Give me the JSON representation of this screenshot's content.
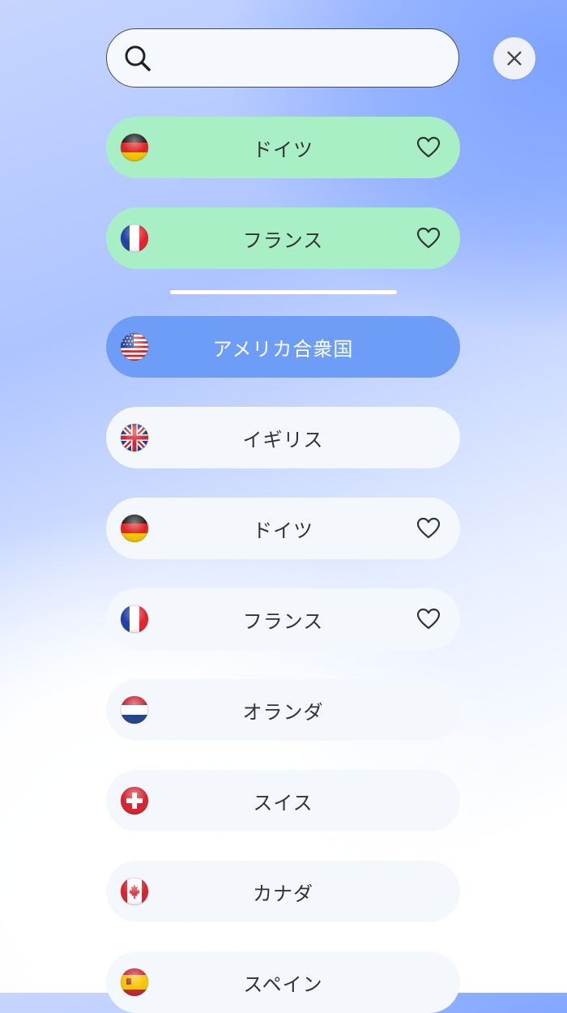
{
  "search": {
    "value": "",
    "placeholder": ""
  },
  "favorites": [
    {
      "name": "ドイツ",
      "flag": "germany-flag",
      "favorite": true
    },
    {
      "name": "フランス",
      "flag": "france-flag",
      "favorite": true
    }
  ],
  "countries": [
    {
      "name": "アメリカ合衆国",
      "flag": "usa-flag",
      "selected": true
    },
    {
      "name": "イギリス",
      "flag": "uk-flag"
    },
    {
      "name": "ドイツ",
      "flag": "germany-flag",
      "favorite": true
    },
    {
      "name": "フランス",
      "flag": "france-flag",
      "favorite": true
    },
    {
      "name": "オランダ",
      "flag": "netherlands-flag"
    },
    {
      "name": "スイス",
      "flag": "switzerland-flag"
    },
    {
      "name": "カナダ",
      "flag": "canada-flag"
    },
    {
      "name": "スペイン",
      "flag": "spain-flag"
    }
  ],
  "colors": {
    "favorite_row": "#a8efc6",
    "selected_row": "#6e9df7",
    "default_row": "#f4f8fd"
  }
}
